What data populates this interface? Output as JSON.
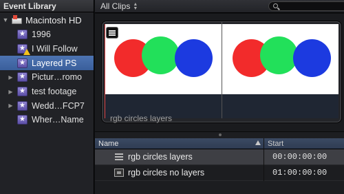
{
  "sidebar": {
    "header": "Event Library",
    "root": {
      "label": "Macintosh HD",
      "expanded": true
    },
    "items": [
      {
        "label": "1996",
        "has_disclosure": false,
        "warning": false,
        "selected": false
      },
      {
        "label": "I Will Follow",
        "has_disclosure": false,
        "warning": true,
        "selected": false
      },
      {
        "label": "Layered PS",
        "has_disclosure": false,
        "warning": false,
        "selected": true
      },
      {
        "label": "Pictur…romo",
        "has_disclosure": true,
        "warning": false,
        "selected": false
      },
      {
        "label": "test footage",
        "has_disclosure": true,
        "warning": false,
        "selected": false
      },
      {
        "label": "Wedd…FCP7",
        "has_disclosure": true,
        "warning": false,
        "selected": false
      },
      {
        "label": "Wher…Name",
        "has_disclosure": false,
        "warning": false,
        "selected": false
      }
    ]
  },
  "toolbar": {
    "filter_label": "All Clips",
    "search_placeholder": ""
  },
  "browser": {
    "clip_caption": "rgb circles layers",
    "frame_colors": {
      "red": "#f22b2b",
      "green": "#22e05a",
      "blue": "#1c3ae0"
    }
  },
  "list": {
    "col_name": "Name",
    "col_start": "Start",
    "rows": [
      {
        "name": "rgb circles layers",
        "start": "00:00:00:00",
        "selected": true,
        "icon": "layers-icon"
      },
      {
        "name": "rgb circles no layers",
        "start": "01:00:00:00",
        "selected": false,
        "icon": "clip-icon"
      }
    ]
  },
  "colors": {
    "selection": "#3a5f9b",
    "accent_purple": "#6a5db8",
    "warning": "#f3c21c"
  }
}
